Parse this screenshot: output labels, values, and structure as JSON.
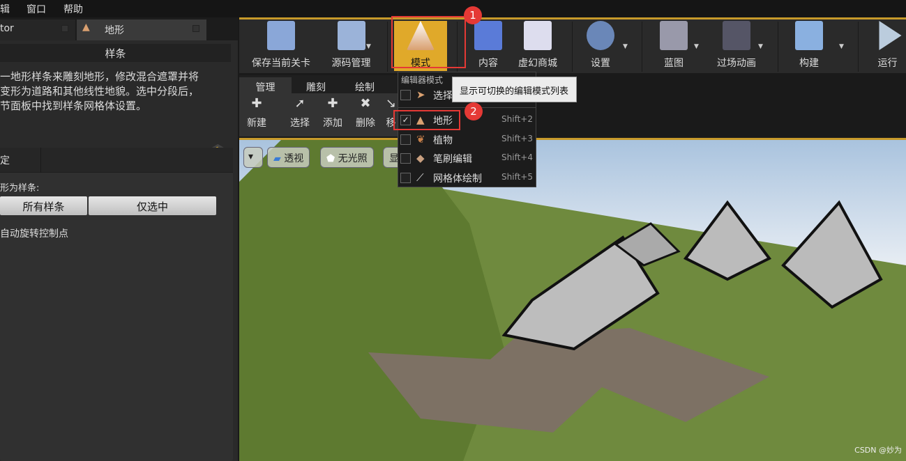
{
  "menu": [
    "辑",
    "窗口",
    "帮助"
  ],
  "left_tabs": [
    {
      "label": "tor"
    },
    {
      "label": "地形"
    }
  ],
  "left": {
    "section": "样条",
    "description": "一地形样条来雕刻地形，修改混合遮罩并将\n变形为道路和其他线性地貌。选中分段后，\n节面板中找到样条网格体设置。",
    "sub_header": "定",
    "deform_label": "形为样条:",
    "btn_all": "所有样条",
    "btn_selected": "仅选中",
    "auto_rotate": "自动旋转控制点"
  },
  "toolbar": [
    {
      "label": "保存当前关卡",
      "icon": "save-icon"
    },
    {
      "label": "源码管理",
      "icon": "source-control-icon"
    },
    {
      "label": "模式",
      "icon": "modes-icon"
    },
    {
      "label": "内容",
      "icon": "content-icon"
    },
    {
      "label": "虚幻商城",
      "icon": "marketplace-icon"
    },
    {
      "label": "设置",
      "icon": "settings-icon"
    },
    {
      "label": "蓝图",
      "icon": "blueprint-icon"
    },
    {
      "label": "过场动画",
      "icon": "cinematics-icon"
    },
    {
      "label": "构建",
      "icon": "build-icon"
    },
    {
      "label": "运行",
      "icon": "play-icon"
    }
  ],
  "mode_tabs": [
    "管理",
    "雕刻",
    "绘制"
  ],
  "tools": [
    {
      "label": "新建"
    },
    {
      "label": "选择"
    },
    {
      "label": "添加"
    },
    {
      "label": "删除"
    },
    {
      "label": "移"
    }
  ],
  "viewport": {
    "perspective": "透视",
    "unlit": "无光照",
    "show": "显"
  },
  "dropdown": {
    "header": "编辑器模式",
    "items": [
      {
        "label": "选择",
        "shortcut": "",
        "checked": false
      },
      {
        "label": "地形",
        "shortcut": "Shift+2",
        "checked": true
      },
      {
        "label": "植物",
        "shortcut": "Shift+3",
        "checked": false
      },
      {
        "label": "笔刷编辑",
        "shortcut": "Shift+4",
        "checked": false
      },
      {
        "label": "网格体绘制",
        "shortcut": "Shift+5",
        "checked": false
      }
    ]
  },
  "tooltip": "显示可切换的编辑模式列表",
  "badges": [
    "1",
    "2"
  ],
  "watermark": "CSDN @妙为",
  "colors": {
    "accent": "#c79a2a",
    "annotation": "#e53935"
  }
}
